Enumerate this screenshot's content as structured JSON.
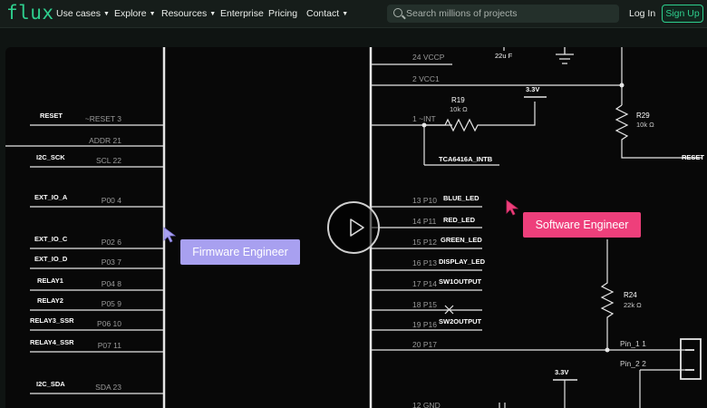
{
  "nav": {
    "logo": "flux",
    "items": [
      {
        "label": "Use cases",
        "has_menu": true
      },
      {
        "label": "Explore",
        "has_menu": true
      },
      {
        "label": "Resources",
        "has_menu": true
      },
      {
        "label": "Enterprise",
        "has_menu": false
      },
      {
        "label": "Pricing",
        "has_menu": false
      },
      {
        "label": "Contact",
        "has_menu": true
      }
    ],
    "search_placeholder": "Search millions of projects",
    "login": "Log In",
    "signup": "Sign Up"
  },
  "schematic": {
    "left_nets": [
      "RESET",
      "I2C_SCK",
      "EXT_IO_A",
      "EXT_IO_C",
      "EXT_IO_D",
      "RELAY1",
      "RELAY2",
      "RELAY3_SSR",
      "RELAY4_SSR",
      "I2C_SDA"
    ],
    "left_pins": [
      "~RESET 3",
      "ADDR 21",
      "SCL 22",
      "P00 4",
      "P02 6",
      "P03 7",
      "P04 8",
      "P05 9",
      "P06 10",
      "P07 11",
      "SDA 23"
    ],
    "right_pins": [
      "24 VCCP",
      "2 VCC1",
      "1 ~INT",
      "13 P10",
      "14 P11",
      "15 P12",
      "16 P13",
      "17 P14",
      "18 P15",
      "19 P16",
      "20 P17",
      "12 GND"
    ],
    "right_nets": [
      "BLUE_LED",
      "RED_LED",
      "GREEN_LED",
      "DISPLAY_LED",
      "SW1OUTPUT",
      "SW2OUTPUT"
    ],
    "labels": {
      "cap": "22u F",
      "r19": "R19",
      "r19_val": "10k Ω",
      "v33": "3.3V",
      "v33_b": "3.3V",
      "r29": "R29",
      "r29_val": "10k Ω",
      "int_net": "TCA6416A_INTB",
      "reset_net": "RESET",
      "r24": "R24",
      "r24_val": "22k Ω",
      "pin1": "Pin_1 1",
      "pin2": "Pin_2 2"
    }
  },
  "badges": {
    "firmware": "Firmware Engineer",
    "software": "Software Engineer"
  },
  "colors": {
    "accent": "#2ecf8e",
    "firmware": "#a8a0f0",
    "software": "#ee3f7b"
  },
  "icons": [
    "search-icon",
    "chevron-down-icon",
    "play-icon",
    "cursor-icon"
  ]
}
